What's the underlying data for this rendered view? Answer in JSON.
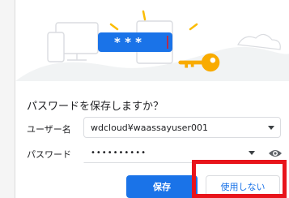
{
  "dialog": {
    "prompt": "パスワードを保存しますか？",
    "username_label": "ユーザー名",
    "username_value": "wdcloud¥waassayuser001",
    "password_label": "パスワード",
    "password_value": "••••••••••",
    "save_button": "保存",
    "never_button": "使用しない"
  },
  "illustration": {
    "masked_text": "* * *"
  },
  "icons": {
    "key": "key-icon",
    "eye": "eye-icon",
    "dropdown": "chevron-down-icon"
  },
  "colors": {
    "accent": "#1a73e8",
    "key": "#f9ab00",
    "highlight": "#e8141b"
  }
}
